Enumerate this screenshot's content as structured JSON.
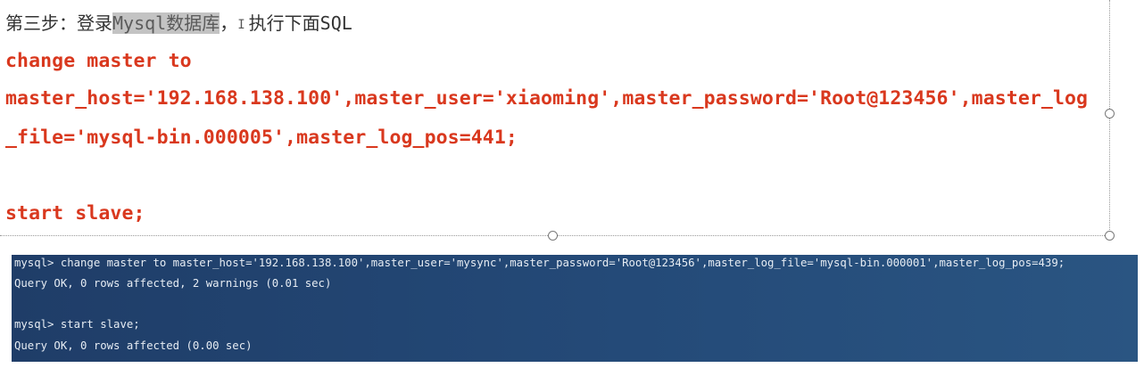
{
  "slide": {
    "step_prefix": "第三步：登录",
    "step_highlight": "Mysql数据库",
    "step_separator": "，",
    "step_suffix": "执行下面SQL",
    "cursor_glyph": "I",
    "sql_line_1": "change master to",
    "sql_line_2": "master_host='192.168.138.100',master_user='xiaoming',master_password='Root@123456',master_log",
    "sql_line_3": "_file='mysql-bin.000005',master_log_pos=441;",
    "sql_line_4": "start slave;"
  },
  "terminal": {
    "line_1": "mysql> change master to master_host='192.168.138.100',master_user='mysync',master_password='Root@123456',master_log_file='mysql-bin.000001',master_log_pos=439;",
    "line_2": "Query OK, 0 rows affected, 2 warnings (0.01 sec)",
    "line_3": "mysql> start slave;",
    "line_4": "Query OK, 0 rows affected (0.00 sec)"
  },
  "colors": {
    "sql_text": "#d9381e",
    "terminal_bg": "#244a78",
    "highlight_bg": "#c3c3c3"
  }
}
